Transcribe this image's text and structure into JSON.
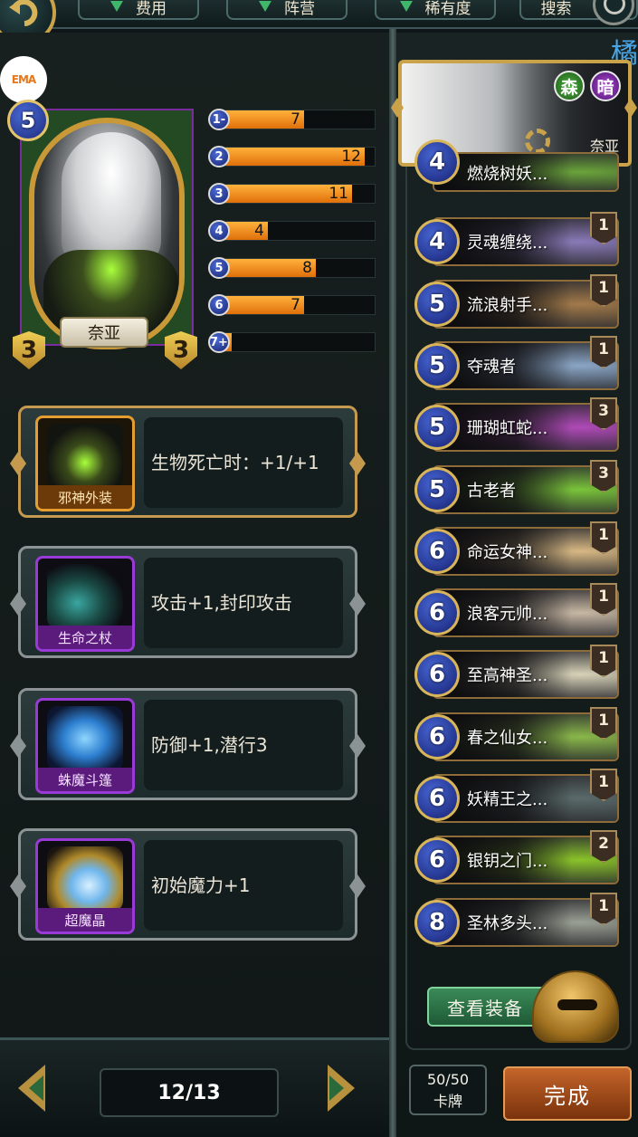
{
  "filters": {
    "cost_label": "费用",
    "faction_label": "阵营",
    "rarity_label": "稀有度",
    "search_label": "搜索"
  },
  "corner_char": "橘",
  "logo_text": "EMA",
  "hero": {
    "name": "奈亚",
    "cost": "5",
    "attack": "3",
    "health": "3"
  },
  "mana_curve": [
    {
      "label": "1-",
      "value": 7
    },
    {
      "label": "2",
      "value": 12
    },
    {
      "label": "3",
      "value": 11
    },
    {
      "label": "4",
      "value": 4
    },
    {
      "label": "5",
      "value": 8
    },
    {
      "label": "6",
      "value": 7
    },
    {
      "label": "7+",
      "value": 1
    }
  ],
  "mana_curve_max": 13,
  "equipment": [
    {
      "name": "邪神外装",
      "desc": "生物死亡时：+1/+1",
      "rarity": "gold",
      "art_color": "#8cc23a"
    },
    {
      "name": "生命之杖",
      "desc": "攻击+1,封印攻击",
      "rarity": "epic",
      "art_color": "#2c8a8a"
    },
    {
      "name": "蛛魔斗篷",
      "desc": "防御+1,潜行3",
      "rarity": "epic",
      "art_color": "#2d8fd6"
    },
    {
      "name": "超魔晶",
      "desc": "初始魔力+1",
      "rarity": "epic",
      "art_color": "#8fc8f0"
    }
  ],
  "pager": {
    "text": "12/13"
  },
  "hero_banner": {
    "faction_forest": "森",
    "faction_dark": "暗",
    "name": "奈亚"
  },
  "cards": [
    {
      "cost": "4",
      "name": "燃烧树妖...",
      "count": "",
      "color": "#6aa43a"
    },
    {
      "cost": "4",
      "name": "灵魂缠绕...",
      "count": "1",
      "color": "#8a7ab8"
    },
    {
      "cost": "5",
      "name": "流浪射手...",
      "count": "1",
      "color": "#a27a4a"
    },
    {
      "cost": "5",
      "name": "夺魂者",
      "count": "1",
      "color": "#8aa6c6"
    },
    {
      "cost": "5",
      "name": "珊瑚虹蛇...",
      "count": "3",
      "color": "#b04ab8"
    },
    {
      "cost": "5",
      "name": "古老者",
      "count": "3",
      "color": "#7ac43a"
    },
    {
      "cost": "6",
      "name": "命运女神...",
      "count": "1",
      "color": "#d8b884"
    },
    {
      "cost": "6",
      "name": "浪客元帅...",
      "count": "1",
      "color": "#c8b8a4"
    },
    {
      "cost": "6",
      "name": "至高神圣...",
      "count": "1",
      "color": "#d8d2b8"
    },
    {
      "cost": "6",
      "name": "春之仙女...",
      "count": "1",
      "color": "#8ab84a"
    },
    {
      "cost": "6",
      "name": "妖精王之...",
      "count": "1",
      "color": "#5a6a6a"
    },
    {
      "cost": "6",
      "name": "银钥之门...",
      "count": "2",
      "color": "#8ac42a"
    },
    {
      "cost": "8",
      "name": "圣林多头...",
      "count": "1",
      "color": "#9aa094"
    }
  ],
  "view_equipment_label": "查看装备",
  "deck_count": {
    "value": "50/50",
    "label": "卡牌"
  },
  "done_label": "完成"
}
